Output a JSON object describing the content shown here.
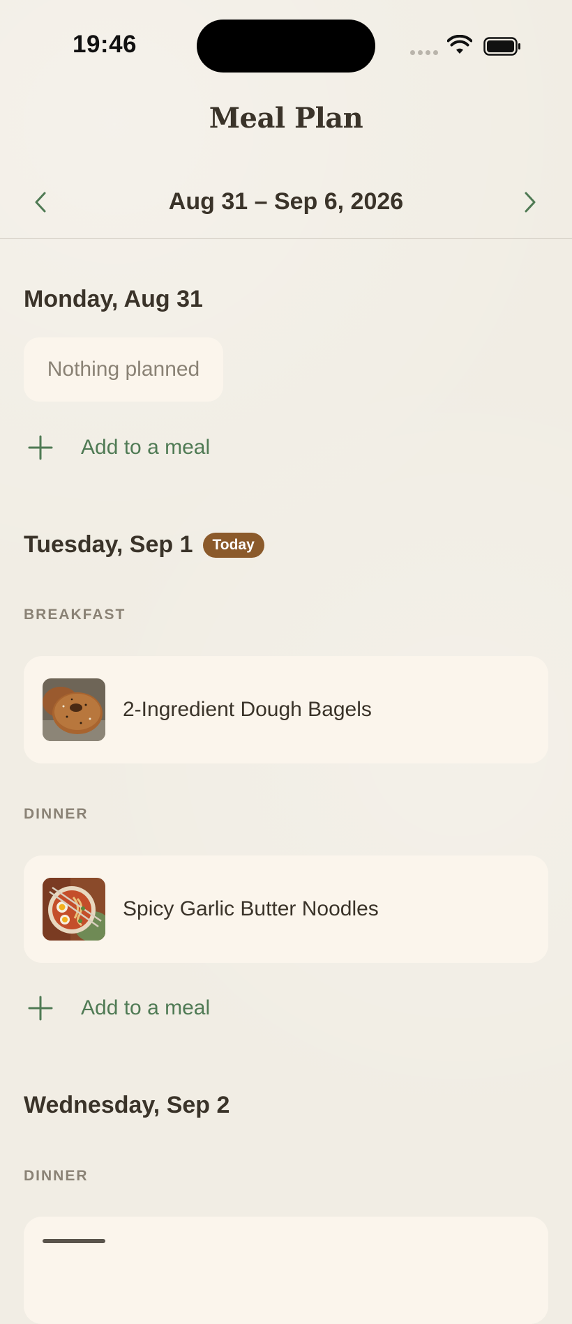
{
  "status_bar": {
    "time": "19:46",
    "icons": [
      "cellular-dots-icon",
      "wifi-icon",
      "battery-icon"
    ]
  },
  "header": {
    "title": "Meal Plan",
    "week_range": "Aug 31 – Sep 6, 2026",
    "prev_icon": "chevron-left-icon",
    "next_icon": "chevron-right-icon"
  },
  "days": [
    {
      "title": "Monday, Aug 31",
      "empty_text": "Nothing planned",
      "add_label": "Add to a meal"
    },
    {
      "title": "Tuesday, Sep 1",
      "badge": "Today",
      "meals": [
        {
          "label": "BREAKFAST",
          "recipe": "2-Ingredient Dough Bagels",
          "thumb": "bagel-photo"
        },
        {
          "label": "DINNER",
          "recipe": "Spicy Garlic Butter Noodles",
          "thumb": "noodles-photo"
        }
      ],
      "add_label": "Add to a meal"
    },
    {
      "title": "Wednesday, Sep 2",
      "meals": [
        {
          "label": "DINNER"
        }
      ]
    }
  ],
  "colors": {
    "background": "#f1ede4",
    "card": "#fbf5ec",
    "accent_green": "#4f7a54",
    "badge_brown": "#8b5a2b",
    "text": "#3a3329",
    "muted": "#8a8275"
  }
}
